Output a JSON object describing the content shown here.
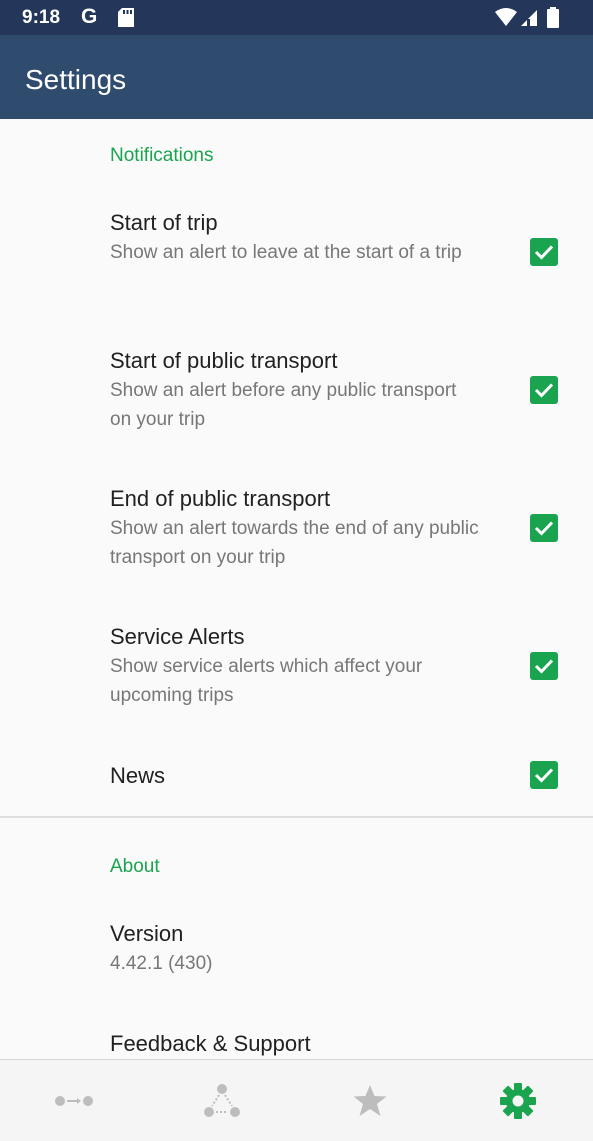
{
  "status_bar": {
    "time": "9:18",
    "google_letter": "G",
    "icons": [
      "sd-card-icon",
      "wifi-icon",
      "signal-icon",
      "battery-icon"
    ]
  },
  "app_bar": {
    "title": "Settings"
  },
  "sections": {
    "notifications": {
      "header": "Notifications",
      "items": [
        {
          "title": "Start of trip",
          "summary": "Show an alert to leave at the start of a trip",
          "checked": true
        },
        {
          "title": "Start of public transport",
          "summary": "Show an alert before any public transport on your trip",
          "checked": true
        },
        {
          "title": "End of public transport",
          "summary": "Show an alert towards the end of any public transport on your trip",
          "checked": true
        },
        {
          "title": "Service Alerts",
          "summary": "Show service alerts which affect your upcoming trips",
          "checked": true
        },
        {
          "title": "News",
          "checked": true
        }
      ]
    },
    "about": {
      "header": "About",
      "items": [
        {
          "title": "Version",
          "summary": "4.42.1 (430)"
        },
        {
          "title": "Feedback & Support"
        }
      ]
    }
  },
  "bottom_nav": {
    "items": [
      {
        "icon": "route-icon",
        "selected": false
      },
      {
        "icon": "network-icon",
        "selected": false
      },
      {
        "icon": "star-icon",
        "selected": false
      },
      {
        "icon": "gear-icon",
        "selected": true
      }
    ]
  },
  "colors": {
    "status_bar": "#24375a",
    "app_bar": "#2f4b6e",
    "accent": "#1aa44f",
    "inactive_icon": "#bdbdbd"
  }
}
